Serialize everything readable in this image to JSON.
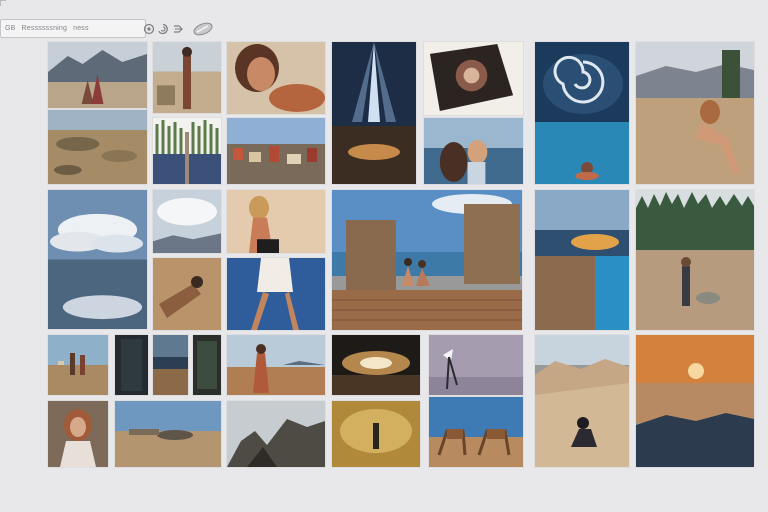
{
  "toolbar": {
    "label_1": "GB",
    "label_2": "Ressssssning",
    "label_3": "ness"
  },
  "toolbar_icons": [
    "zoom-icon",
    "settings-swirl-icon",
    "shuffle-icon",
    "brush-icon"
  ],
  "gallery": {
    "items": [
      {
        "name": "gallery-thumb-mountain-lake"
      },
      {
        "name": "gallery-thumb-desert-figures"
      },
      {
        "name": "gallery-thumb-portrait-woman"
      },
      {
        "name": "gallery-thumb-sky-light-rays"
      },
      {
        "name": "gallery-thumb-tilted-art"
      },
      {
        "name": "gallery-thumb-swirl-sea"
      },
      {
        "name": "gallery-thumb-woman-on-rock"
      },
      {
        "name": "gallery-thumb-dry-field"
      },
      {
        "name": "gallery-thumb-tall-grass"
      },
      {
        "name": "gallery-thumb-town-view"
      },
      {
        "name": "gallery-thumb-couple-by-water"
      },
      {
        "name": "gallery-thumb-clouds-lake"
      },
      {
        "name": "gallery-thumb-bright-sky"
      },
      {
        "name": "gallery-thumb-blonde-woman"
      },
      {
        "name": "gallery-thumb-rock-arch-sea"
      },
      {
        "name": "gallery-thumb-glowing-island"
      },
      {
        "name": "gallery-thumb-forest-meadow"
      },
      {
        "name": "gallery-thumb-sand-figure"
      },
      {
        "name": "gallery-thumb-legs-blue"
      },
      {
        "name": "gallery-thumb-cliff-coast"
      },
      {
        "name": "gallery-thumb-walker-field"
      },
      {
        "name": "gallery-thumb-beach-people"
      },
      {
        "name": "gallery-thumb-dark-panel-1"
      },
      {
        "name": "gallery-thumb-seaside-dark"
      },
      {
        "name": "gallery-thumb-dark-panel-2"
      },
      {
        "name": "gallery-thumb-desert-woman"
      },
      {
        "name": "gallery-thumb-glowing-boat"
      },
      {
        "name": "gallery-thumb-beach-chairs"
      },
      {
        "name": "gallery-thumb-dune-sitter"
      },
      {
        "name": "gallery-thumb-sunset-horizon"
      },
      {
        "name": "gallery-thumb-red-hair-portrait"
      },
      {
        "name": "gallery-thumb-desert-plain"
      },
      {
        "name": "gallery-thumb-rocky-hill"
      },
      {
        "name": "gallery-thumb-golden-path"
      }
    ]
  }
}
